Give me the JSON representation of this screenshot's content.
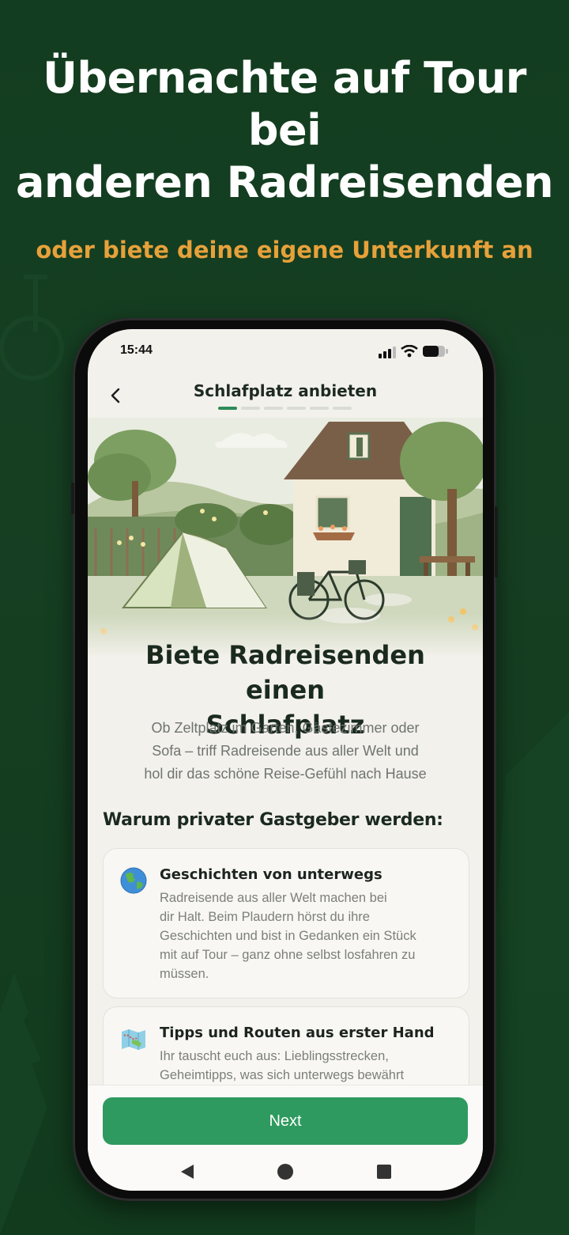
{
  "promo": {
    "title_line1": "Übernachte auf Tour bei",
    "title_line2": "anderen Radreisenden",
    "subtitle": "oder biete deine eigene Unterkunft an"
  },
  "status_bar": {
    "time": "15:44",
    "icons": [
      "signal-icon",
      "wifi-icon",
      "battery-icon"
    ]
  },
  "header": {
    "back_icon": "chevron-left-icon",
    "title": "Schlafplatz anbieten",
    "progress": {
      "current_step": 1,
      "total_steps": 6
    }
  },
  "hero": {
    "headline_line1": "Biete Radreisenden einen",
    "headline_line2": "Schlafplatz",
    "intro_line1": "Ob Zeltplatz im Garten, Gästezimmer oder",
    "intro_line2": "Sofa – triff Radreisende aus aller Welt und",
    "intro_line3": "hol dir das schöne Reise-Gefühl nach Hause"
  },
  "benefits": {
    "section_title": "Warum privater Gastgeber werden:",
    "items": [
      {
        "icon": "globe-icon",
        "title": "Geschichten von unterwegs",
        "lines": [
          "Radreisende aus aller Welt machen bei",
          "dir Halt. Beim Plaudern hörst du ihre",
          "Geschichten und bist in Gedanken ein Stück",
          "mit auf Tour – ganz ohne selbst losfahren zu",
          "müssen."
        ]
      },
      {
        "icon": "map-icon",
        "title": "Tipps und Routen aus erster Hand",
        "lines": [
          "Ihr tauscht euch aus: Lieblingsstrecken,",
          "Geheimtipps, was sich unterwegs bewährt"
        ]
      }
    ]
  },
  "footer": {
    "next_label": "Next"
  },
  "system_nav": [
    "back-triangle-icon",
    "home-circle-icon",
    "recents-square-icon"
  ],
  "colors": {
    "background": "#133d20",
    "accent_orange": "#e7a13a",
    "primary_green": "#2f9a5f",
    "progress_active": "#2e8b57"
  }
}
